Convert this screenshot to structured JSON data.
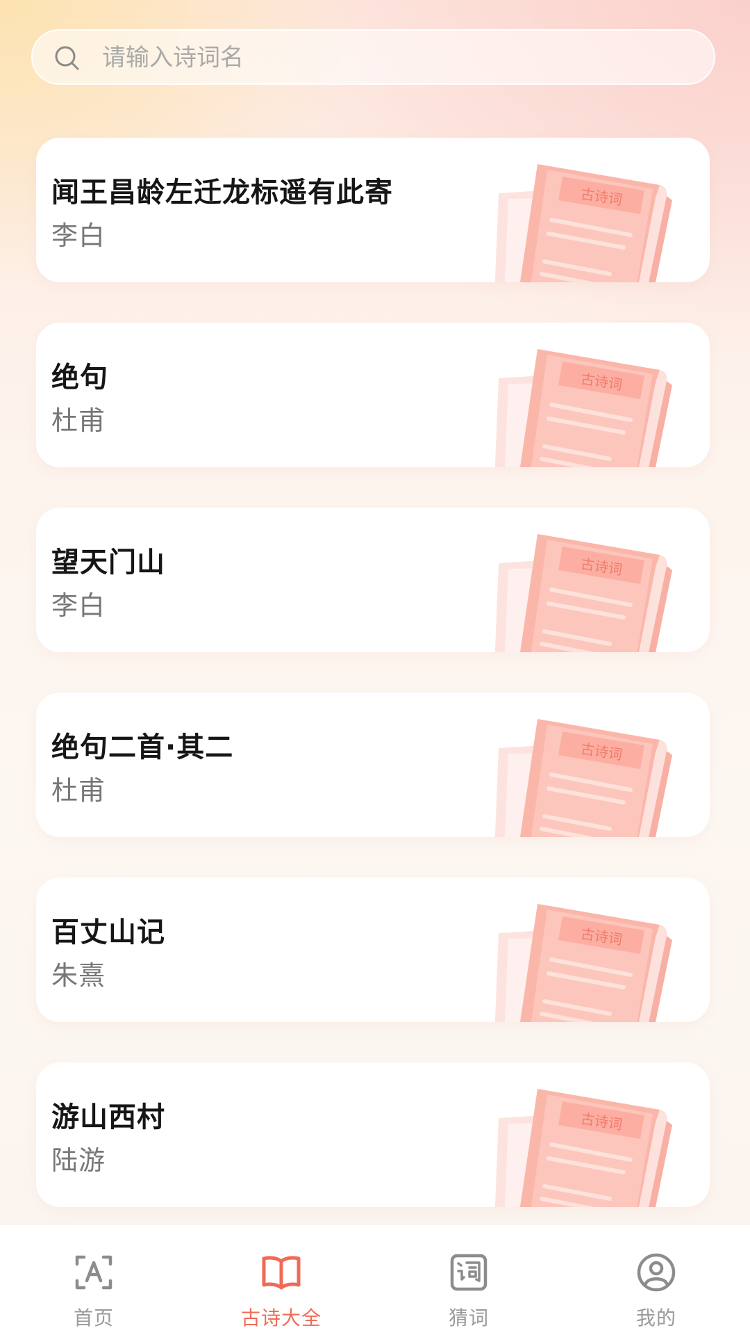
{
  "search": {
    "placeholder": "请输入诗词名",
    "value": ""
  },
  "book_tag": "古诗词",
  "poems": [
    {
      "title": "闻王昌龄左迁龙标遥有此寄",
      "author": "李白"
    },
    {
      "title": "绝句",
      "author": "杜甫"
    },
    {
      "title": "望天门山",
      "author": "李白"
    },
    {
      "title": "绝句二首·其二",
      "author": "杜甫"
    },
    {
      "title": "百丈山记",
      "author": "朱熹"
    },
    {
      "title": "游山西村",
      "author": "陆游"
    }
  ],
  "nav": {
    "active": "古诗大全",
    "items": [
      {
        "label": "首页",
        "icon": "scan-text-icon"
      },
      {
        "label": "古诗大全",
        "icon": "open-book-icon"
      },
      {
        "label": "猜词",
        "icon": "ci-character-icon"
      },
      {
        "label": "我的",
        "icon": "user-circle-icon"
      }
    ]
  },
  "colors": {
    "accent": "#ef6b57",
    "inactive": "#9a9a9a",
    "book": "#fbb6aa"
  }
}
